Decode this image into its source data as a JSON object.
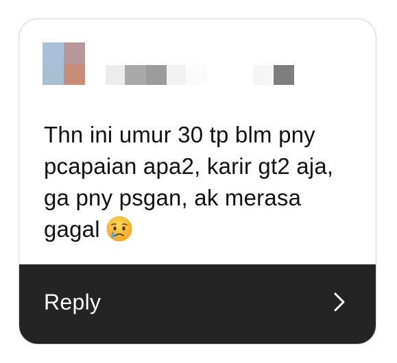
{
  "message": {
    "text": "Thn ini umur 30 tp blm pny pcapaian apa2, karir gt2 aja, ga pny psgan, ak merasa gagal",
    "emoji": "crying-face-emoji"
  },
  "reply": {
    "label": "Reply",
    "icon": "chevron-right-icon"
  },
  "colors": {
    "reply_bar_bg": "#242424",
    "card_border": "#d4d4d4",
    "text": "#111111"
  }
}
